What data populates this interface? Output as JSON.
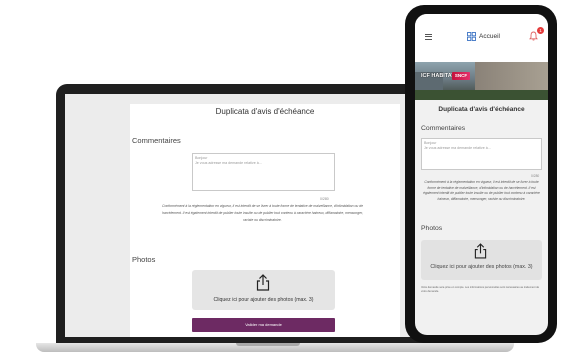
{
  "page": {
    "title": "Duplicata d'avis d'échéance",
    "comments_label": "Commentaires",
    "textarea_lines": [
      "Bonjour",
      "Je vous adresse ma demande relative à..."
    ],
    "counter": "0/280",
    "notice": "Conformément à la réglementation en vigueur, il est interdit de se livrer à toute forme de tentative de malveillance, d'intimidation ou de harcèlement. Il est également interdit de publier toute insulte ou de publier tout contenu à caractère haineux, diffamatoire, mensonger, raciste ou discriminatoire.",
    "photos_label": "Photos",
    "upload_label": "Cliquez ici pour ajouter des photos (max. 3)",
    "submit_label": "Valider ma demande"
  },
  "phone": {
    "header": {
      "home_label": "Accueil",
      "notification_count": "1"
    },
    "hero": {
      "brand_text": "ICF HABITAT",
      "brand_badge": "SNCF"
    },
    "footnote": "Votre demande sera prise en compte. Les informations personnelles sont nécessaires au traitement de votre demande."
  },
  "colors": {
    "submit_button": "#6d2a63",
    "upload_box": "#e5e5e5",
    "badge": "#e43a3a"
  },
  "icons": [
    "share-upload-icon",
    "menu-icon",
    "home-grid-icon",
    "bell-icon"
  ]
}
